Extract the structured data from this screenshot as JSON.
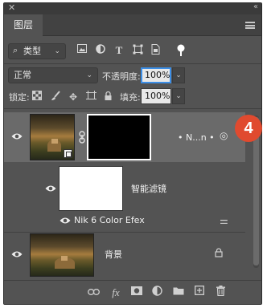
{
  "panel": {
    "title_tab": "图层",
    "close_glyph": "✕",
    "collapse_glyph": "‹‹"
  },
  "filter": {
    "kind_label": "类型",
    "icons": [
      "image-filter-icon",
      "adjustment-filter-icon",
      "type-filter-icon",
      "shape-filter-icon",
      "smart-object-filter-icon",
      "filter-toggle-icon"
    ]
  },
  "blend": {
    "mode": "正常",
    "opacity_label": "不透明度:",
    "opacity_value": "100%"
  },
  "lock": {
    "label": "锁定:",
    "fill_label": "填充:",
    "fill_value": "100%"
  },
  "layers": [
    {
      "name": "• N...n •",
      "selected": true,
      "has_mask": true
    },
    {
      "name": "智能滤镜",
      "type": "smart-filter-mask"
    },
    {
      "name": "Nik 6 Color Efex",
      "type": "filter-entry"
    },
    {
      "name": "背景",
      "locked": true
    }
  ],
  "callout": {
    "number": "4",
    "color": "#e04a2f"
  },
  "bottom_icons": [
    "link-icon",
    "fx-icon",
    "mask-icon",
    "adjustment-icon",
    "folder-icon",
    "new-layer-icon",
    "trash-icon"
  ]
}
